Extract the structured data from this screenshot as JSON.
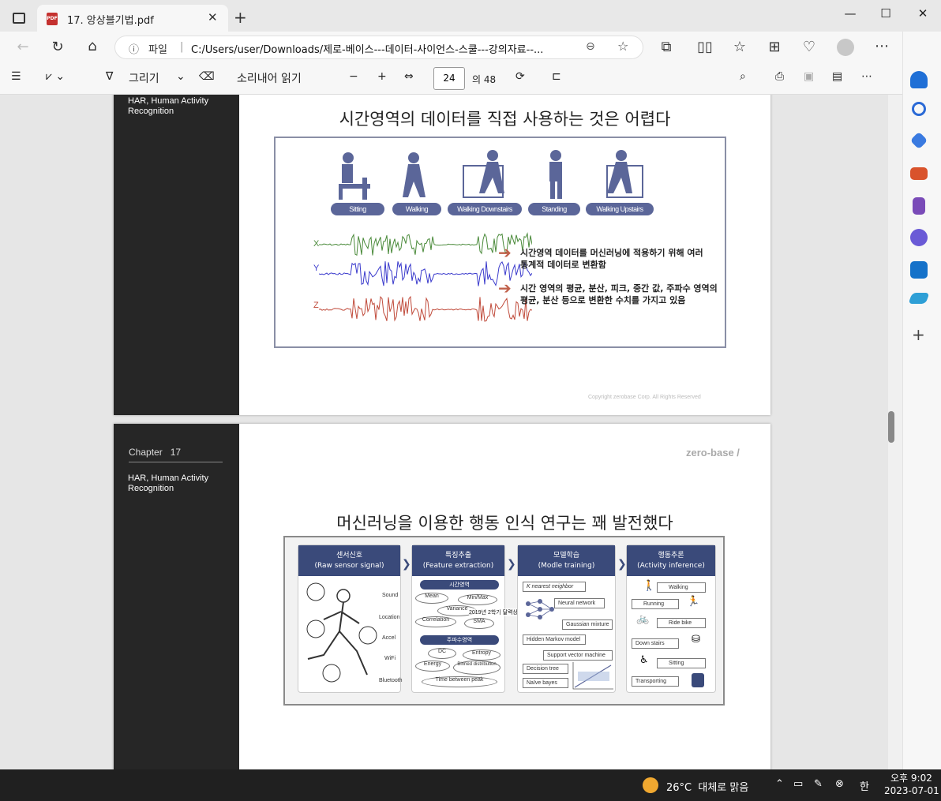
{
  "browser": {
    "tab_title": "17. 앙상블기법.pdf",
    "pdf_badge": "PDF",
    "address_prefix": "파일",
    "address_path": "C:/Users/user/Downloads/제로-베이스---데이터-사이언스-스쿨---강의자료--...",
    "new_tab": "+",
    "tab_close": "✕"
  },
  "pdf_toolbar": {
    "draw_label": "그리기",
    "read_aloud_label": "소리내어 읽기",
    "current_page": "24",
    "total_pages": "의 48",
    "zoom_out": "−",
    "zoom_in": "+"
  },
  "page1": {
    "sidebar_text": "HAR, Human Activity Recognition",
    "title": "시간영역의 데이터를 직접 사용하는 것은 어렵다",
    "activities": [
      "Sitting",
      "Walking",
      "Walking Downstairs",
      "Standing",
      "Walking Upstairs"
    ],
    "axes": [
      "X",
      "Y",
      "Z"
    ],
    "note1": "시간영역 데이터를 머신러닝에 적용하기 위해 여러 통계적 데이터로 변환함",
    "note2": "시간 영역의 평균, 분산, 피크, 중간 값, 주파수 영역의 평균, 분산 등으로 변환한 수치를 가지고 있음",
    "copyright": "Copyright zerobase Corp. All Rights Reserved",
    "colors": {
      "x": "#4a8a3a",
      "y": "#3a3acc",
      "z": "#c04a3a"
    }
  },
  "page2": {
    "chapter": "Chapter   17",
    "sidebar_text": "HAR, Human Activity Recognition",
    "logo": "zero-base /",
    "title": "머신러닝을 이용한 행동 인식 연구는 꽤 발전했다",
    "columns": [
      {
        "title": "센서신호",
        "subtitle": "(Raw sensor signal)"
      },
      {
        "title": "특징추출",
        "subtitle": "(Feature extraction)"
      },
      {
        "title": "모델학습",
        "subtitle": "(Modle training)"
      },
      {
        "title": "행동추론",
        "subtitle": "(Activity inference)"
      }
    ],
    "sensors": [
      "Sound",
      "Location",
      "Accel",
      "WiFi",
      "Bluetooth"
    ],
    "time_domain": "시간영역",
    "freq_domain": "주파수영역",
    "time_features": [
      "Mean",
      "Min/Max",
      "Variance",
      "Correlation",
      "SMA"
    ],
    "freq_features": [
      "DC",
      "Entropy",
      "Energy",
      "Binned distribution",
      "Time between peak"
    ],
    "overlay_text": "2019년 2학기 달력상으로",
    "models": [
      "K nearest neighbor",
      "Neural network",
      "Gaussian mixture",
      "Hidden Markov model",
      "Support vector machine",
      "Decision tree",
      "Naïve bayes"
    ],
    "activities": [
      "Walking",
      "Running",
      "Ride bike",
      "Down stairs",
      "Sitting",
      "Transporting"
    ]
  },
  "taskbar": {
    "weather": "26°C  대체로 맑음",
    "time": "오후 9:02",
    "date": "2023-07-01",
    "ime": "한"
  }
}
